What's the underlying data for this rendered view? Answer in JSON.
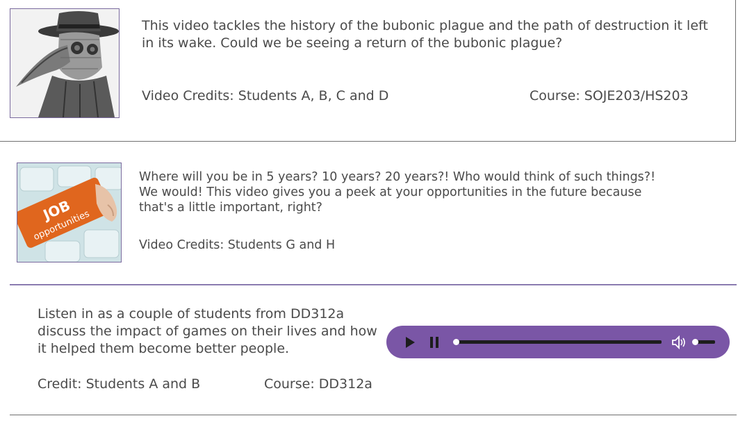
{
  "cards": [
    {
      "description": "This video tackles the history of the bubonic plague and the path of destruction it left in its wake. Could we be seeing a return of the bubonic plague?",
      "credit": "Video Credits: Students A, B, C and D",
      "course": "Course: SOJE203/HS203"
    },
    {
      "description": "Where will you be in 5 years? 10 years? 20 years?! Who would think of such things?! We would! This video gives you a peek at your opportunities in the future because that's a little important, right?",
      "credit": "Video Credits: Students G and H",
      "thumbnail_text_line1": "JOB",
      "thumbnail_text_line2": "opportunities"
    },
    {
      "description": "Listen in as a couple of students from DD312a discuss the impact of games on their lives and how it helped them become better people.",
      "credit": "Credit: Students A and B",
      "course": "Course: DD312a"
    }
  ],
  "audio_player": {
    "progress": 0.0,
    "volume": 0.2,
    "color": "#7a56a6"
  },
  "icons": [
    "play-icon",
    "pause-icon",
    "volume-icon"
  ]
}
